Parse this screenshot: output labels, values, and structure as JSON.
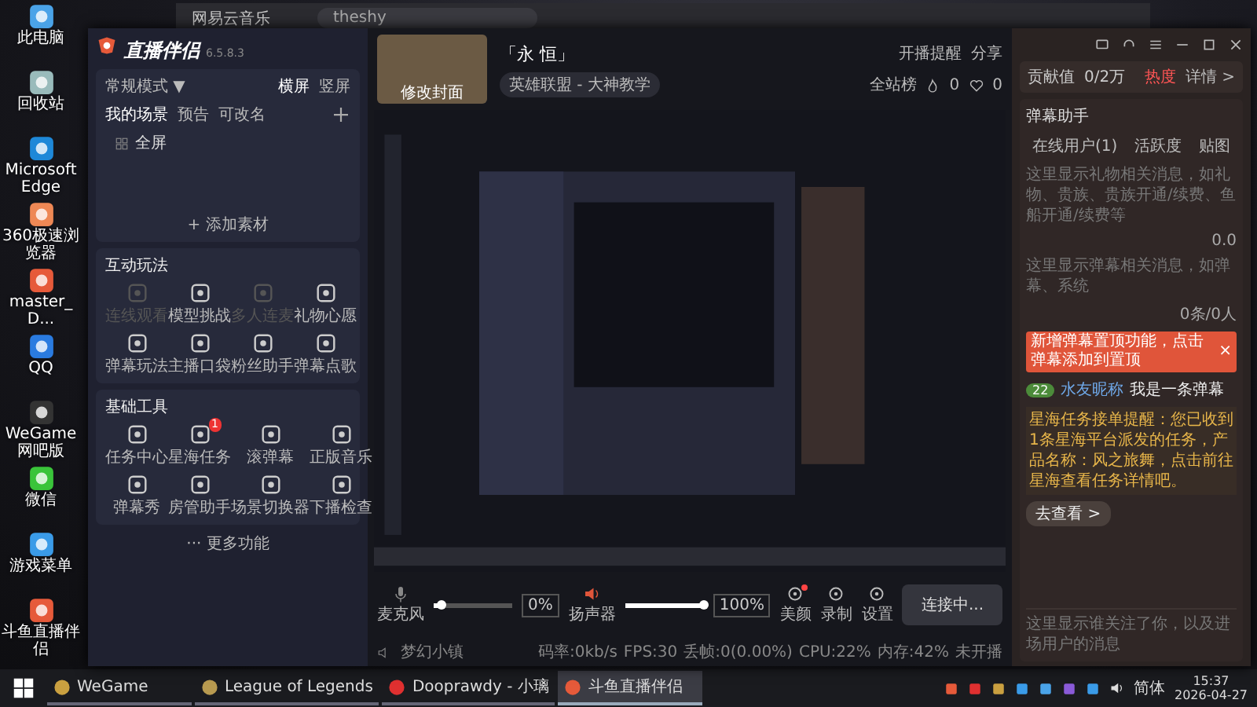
{
  "desktop": {
    "icons": [
      {
        "label": "此电脑"
      },
      {
        "label": "回收站"
      },
      {
        "label": "Microsoft Edge"
      },
      {
        "label": "360极速浏览器"
      },
      {
        "label": "master_D..."
      },
      {
        "label": "QQ"
      },
      {
        "label": "WeGame网吧版"
      },
      {
        "label": "微信"
      },
      {
        "label": "游戏菜单"
      },
      {
        "label": "斗鱼直播伴侣"
      }
    ]
  },
  "background_window": {
    "title": "网易云音乐",
    "search": "theshy"
  },
  "app": {
    "logo": "直播伴侣",
    "version": "6.5.8.3",
    "scene_panel": {
      "mode": "常规模式 ▼",
      "orientations": [
        {
          "label": "横屏",
          "selected": true
        },
        {
          "label": "竖屏",
          "selected": false
        }
      ],
      "scene_tabs": [
        "我的场景",
        "预告",
        "可改名"
      ],
      "scenes": [
        "全屏"
      ],
      "add_source": "+ 添加素材"
    },
    "sections": [
      {
        "title": "互动玩法",
        "tools": [
          {
            "label": "连线观看",
            "disabled": true
          },
          {
            "label": "模型挑战",
            "disabled": false
          },
          {
            "label": "多人连麦",
            "disabled": true
          },
          {
            "label": "礼物心愿",
            "disabled": false
          },
          {
            "label": "弹幕玩法",
            "disabled": false
          },
          {
            "label": "主播口袋",
            "disabled": false
          },
          {
            "label": "粉丝助手",
            "disabled": false
          },
          {
            "label": "弹幕点歌",
            "disabled": false
          }
        ]
      },
      {
        "title": "基础工具",
        "tools": [
          {
            "label": "任务中心",
            "disabled": false
          },
          {
            "label": "星海任务",
            "disabled": false,
            "badge": "1"
          },
          {
            "label": "滚弹幕",
            "disabled": false
          },
          {
            "label": "正版音乐",
            "disabled": false
          },
          {
            "label": "弹幕秀",
            "disabled": false
          },
          {
            "label": "房管助手",
            "disabled": false
          },
          {
            "label": "场景切换器",
            "disabled": false
          },
          {
            "label": "下播检查",
            "disabled": false
          }
        ]
      }
    ],
    "more": "··· 更多功能",
    "room": {
      "cover_label": "修改封面",
      "title": "「永 恒」",
      "category": "英雄联盟 - 大神教学",
      "actions": [
        "开播提醒",
        "分享"
      ],
      "rank": "全站榜",
      "hot": "0",
      "likes": "0"
    },
    "audio": [
      {
        "label": "麦克风",
        "level": 0.1,
        "reading": "0%"
      },
      {
        "label": "扬声器",
        "level": 1,
        "reading": "100%"
      }
    ],
    "tools": [
      {
        "label": "美颜",
        "new": true
      },
      {
        "label": "录制",
        "new": false
      },
      {
        "label": "设置",
        "new": false
      }
    ],
    "connect_button": "连接中...",
    "status_bar": {
      "scene": "梦幻小镇",
      "stats": [
        "码率:0kb/s",
        "FPS:30",
        "丢帧:0(0.00%)",
        "CPU:22%",
        "内存:42%"
      ],
      "live_state": "未开播"
    },
    "side": {
      "contribution": "贡献值",
      "contribution_value": "0/2万",
      "heat": "热度",
      "details": "详情 >",
      "title": "弹幕助手",
      "tabs": [
        {
          "label": "在线用户(1)",
          "selected": false
        },
        {
          "label": "活跃度",
          "selected": false
        },
        {
          "label": "贴图",
          "selected": false
        }
      ],
      "gift_hint": "这里显示礼物相关消息，如礼物、贵族、贵族开通/续费、鱼船开通/续费等",
      "gift_count": "0.0",
      "chat_hint": "这里显示弹幕相关消息，如弹幕、系统",
      "chat_count": "0条/0人",
      "tooltip": "新增弹幕置顶功能，点击弹幕添加到置顶",
      "tooltip_close": "×",
      "messages": [
        {
          "level": "22",
          "nickname": "水友昵称",
          "text": "我是一条弹幕"
        }
      ],
      "notice": "星海任务接单提醒：您已收到1条星海平台派发的任务，产品名称：风之旅舞，点击前往星海查看任务详情吧。",
      "notice_button": "去查看 >",
      "follow_hint": "这里显示谁关注了你，以及进场用户的消息"
    }
  },
  "taskbar": {
    "items": [
      {
        "label": "WeGame",
        "selected": false
      },
      {
        "label": "League of Legends",
        "selected": false
      },
      {
        "label": "Dooprawdy - 小璃",
        "selected": false
      },
      {
        "label": "斗鱼直播伴侣",
        "selected": true
      }
    ],
    "language": "简体",
    "time": "15:37",
    "date": "2026-04-27"
  }
}
